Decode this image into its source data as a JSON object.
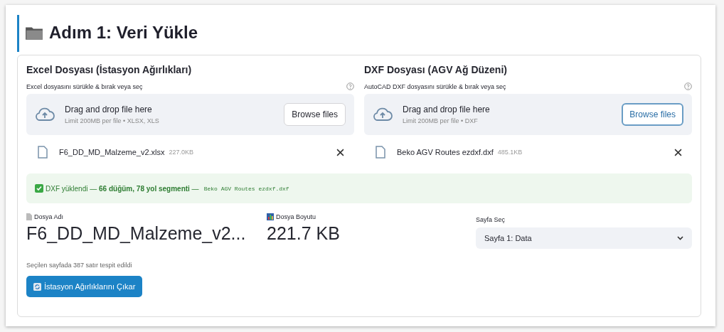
{
  "title": "Adım 1: Veri Yükle",
  "uploaders": [
    {
      "heading": "Excel Dosyası (İstasyon Ağırlıkları)",
      "label": "Excel dosyasını sürükle & bırak veya seç",
      "drop_title": "Drag and drop file here",
      "drop_hint": "Limit 200MB per file • XLSX, XLS",
      "button": "Browse files",
      "focused": false,
      "file": {
        "name": "F6_DD_MD_Malzeme_v2.xlsx",
        "size": "227.0KB"
      }
    },
    {
      "heading": "DXF Dosyası (AGV Ağ Düzeni)",
      "label": "AutoCAD DXF dosyasını sürükle & bırak veya seç",
      "drop_title": "Drag and drop file here",
      "drop_hint": "Limit 200MB per file • DXF",
      "button": "Browse files",
      "focused": true,
      "file": {
        "name": "Beko AGV Routes ezdxf.dxf",
        "size": "485.1KB"
      }
    }
  ],
  "success": {
    "message": "DXF yüklendi — **66 düğüm, 78 yol segmenti** —",
    "code": "Beko AGV Routes ezdxf.dxf"
  },
  "metrics": [
    {
      "kind": "file",
      "label": "Dosya Adı",
      "value": "F6_DD_MD_Malzeme_v2..."
    },
    {
      "kind": "size",
      "label": "Dosya Boyutu",
      "value": "221.7 KB"
    }
  ],
  "sheet_select": {
    "label": "Sayfa Seç",
    "value": "Sayfa 1: Data"
  },
  "caption": "Seçilen sayfada 387 satır tespit edildi",
  "action_button": "İstasyon Ağırlıklarını Çıkar"
}
